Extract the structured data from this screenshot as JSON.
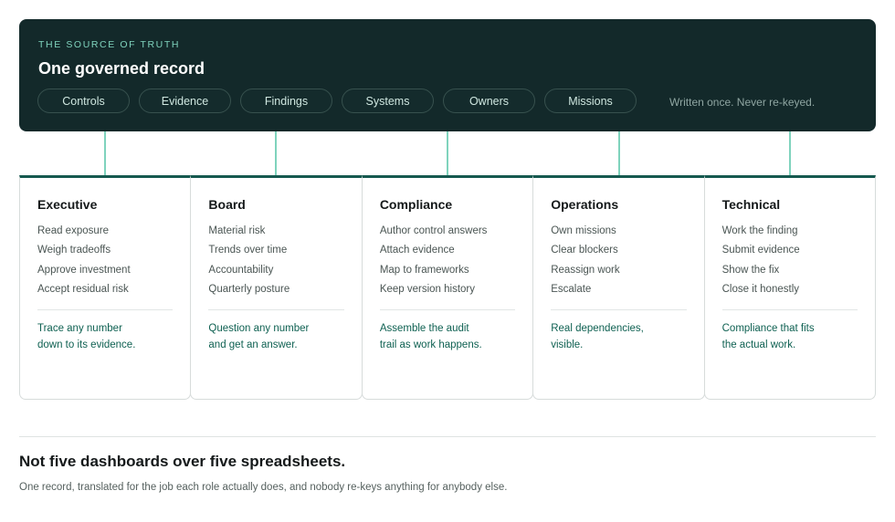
{
  "banner": {
    "eyebrow": "THE SOURCE OF TRUTH",
    "title": "One governed record",
    "pills": [
      "Controls",
      "Evidence",
      "Findings",
      "Systems",
      "Owners",
      "Missions"
    ],
    "tagline": "Written once. Never re-keyed."
  },
  "roles": [
    {
      "title": "Executive",
      "items": [
        "Read exposure",
        "Weigh tradeoffs",
        "Approve investment",
        "Accept residual risk"
      ],
      "outcome": [
        "Trace any number",
        "down to its evidence."
      ]
    },
    {
      "title": "Board",
      "items": [
        "Material risk",
        "Trends over time",
        "Accountability",
        "Quarterly posture"
      ],
      "outcome": [
        "Question any number",
        "and get an answer."
      ]
    },
    {
      "title": "Compliance",
      "items": [
        "Author control answers",
        "Attach evidence",
        "Map to frameworks",
        "Keep version history"
      ],
      "outcome": [
        "Assemble the audit",
        "trail as work happens."
      ]
    },
    {
      "title": "Operations",
      "items": [
        "Own missions",
        "Clear blockers",
        "Reassign work",
        "Escalate"
      ],
      "outcome": [
        "Real dependencies,",
        "visible."
      ]
    },
    {
      "title": "Technical",
      "items": [
        "Work the finding",
        "Submit evidence",
        "Show the fix",
        "Close it honestly"
      ],
      "outcome": [
        "Compliance that fits",
        "the actual work."
      ]
    }
  ],
  "footer": {
    "headline": "Not five dashboards over five spreadsheets.",
    "subline": "One record, translated for the job each role actually does, and nobody re-keys anything for anybody else."
  },
  "colors": {
    "banner_bg": "#13292a",
    "accent": "#7fd3bd",
    "card_top": "#16594f",
    "outcome_text": "#0f6152"
  }
}
